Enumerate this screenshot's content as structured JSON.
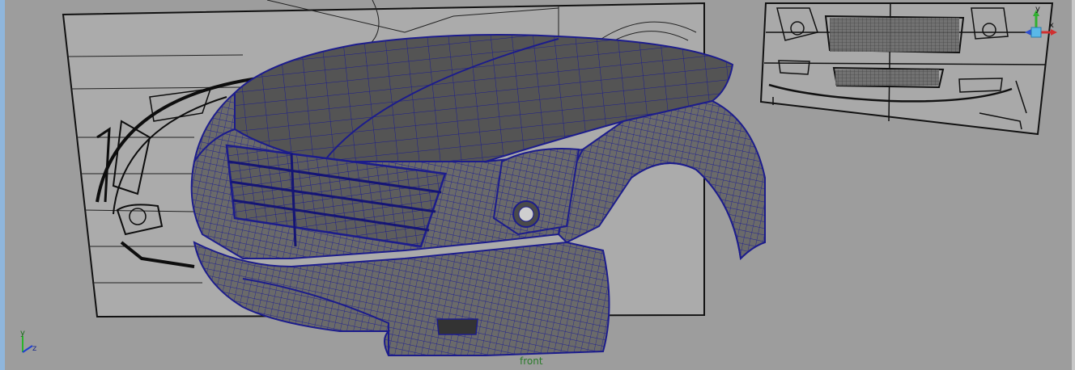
{
  "viewport": {
    "camera_label": "front",
    "top_text": "",
    "axis": {
      "y": "y",
      "z": "z"
    },
    "view_cube": {
      "y": "y",
      "x": "x"
    }
  },
  "colors": {
    "background": "#9d9d9d",
    "wire": "#1c1c8c",
    "model_fill": "#5b5b5b",
    "plane_fill": "#ababab",
    "sketch_line": "#1a1a1a"
  }
}
